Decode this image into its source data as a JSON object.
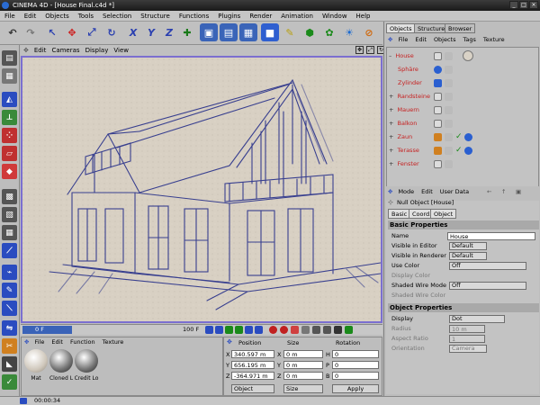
{
  "window": {
    "title": "CINEMA 4D - [House Final.c4d *]"
  },
  "menu": [
    "File",
    "Edit",
    "Objects",
    "Tools",
    "Selection",
    "Structure",
    "Functions",
    "Plugins",
    "Render",
    "Animation",
    "Window",
    "Help"
  ],
  "toolbar": {
    "icons": [
      "undo-icon",
      "redo-icon",
      "select-icon",
      "move-icon",
      "scale-icon",
      "rotate-icon",
      "x-axis-icon",
      "y-axis-icon",
      "z-axis-icon",
      "coord-system-icon",
      "render-view-icon",
      "render-region-icon",
      "render-picture-icon",
      "cube-icon",
      "spline-icon",
      "nurbs-icon",
      "array-icon",
      "deformer-icon",
      "light-icon",
      "camera-icon"
    ],
    "axis_x": "X",
    "axis_y": "Y",
    "axis_z": "Z"
  },
  "viewport": {
    "menu": [
      "Edit",
      "Cameras",
      "Display",
      "View"
    ]
  },
  "timeline": {
    "start": "0 F",
    "end": "100 F"
  },
  "materials": {
    "menu": [
      "File",
      "Edit",
      "Function",
      "Texture"
    ],
    "items": [
      {
        "name": "Mat"
      },
      {
        "name": "Cloned L"
      },
      {
        "name": "Credit Lo"
      }
    ]
  },
  "coordinates": {
    "headers": {
      "position": "Position",
      "size": "Size",
      "rotation": "Rotation"
    },
    "position": {
      "x": "340.597 m",
      "y": "656.195 m",
      "z": "-364.971 m"
    },
    "size": {
      "x": "0 m",
      "y": "0 m",
      "z": "0 m"
    },
    "rotation": {
      "h": "0",
      "p": "0",
      "b": "0"
    },
    "axis_labels": {
      "x": "X",
      "y": "Y",
      "z": "Z",
      "h": "H",
      "p": "P",
      "b": "B"
    },
    "mode": "Object",
    "size_mode": "Size",
    "apply_label": "Apply"
  },
  "status": {
    "time": "00:00:34"
  },
  "objects_panel": {
    "tabs": [
      "Objects",
      "Structure",
      "Browser"
    ],
    "menu": [
      "File",
      "Edit",
      "Objects",
      "Tags",
      "Texture"
    ],
    "items": [
      {
        "name": "House",
        "expanded": true
      },
      {
        "name": "Sphäre"
      },
      {
        "name": "Zylinder"
      },
      {
        "name": "Randsteine",
        "expandable": true
      },
      {
        "name": "Mauern",
        "expandable": true
      },
      {
        "name": "Balkon",
        "expandable": true
      },
      {
        "name": "Zaun",
        "expandable": true
      },
      {
        "name": "Terasse",
        "expandable": true
      },
      {
        "name": "Fenster",
        "expandable": true
      }
    ]
  },
  "attributes": {
    "menu": [
      "Mode",
      "Edit",
      "User Data"
    ],
    "object_title": "Null Object [House]",
    "tabs": [
      "Basic",
      "Coord.",
      "Object"
    ],
    "basic_header": "Basic Properties",
    "basic": [
      {
        "label": "Name",
        "value": "House"
      },
      {
        "label": "Visible in Editor",
        "value": "Default"
      },
      {
        "label": "Visible in Renderer",
        "value": "Default"
      },
      {
        "label": "Use Color",
        "value": "Off"
      },
      {
        "label": "Display Color",
        "value": ""
      },
      {
        "label": "Shaded Wire Mode",
        "value": "Off"
      },
      {
        "label": "Shaded Wire Color",
        "value": ""
      }
    ],
    "object_header": "Object Properties",
    "object": [
      {
        "label": "Display",
        "value": "Dot"
      },
      {
        "label": "Radius",
        "value": "10 m"
      },
      {
        "label": "Aspect Ratio",
        "value": "1"
      },
      {
        "label": "Orientation",
        "value": "Camera"
      }
    ]
  }
}
